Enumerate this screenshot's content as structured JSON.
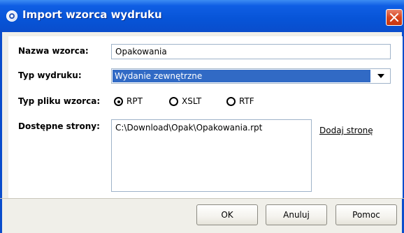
{
  "window": {
    "title": "Import wzorca wydruku",
    "icon": "app-icon"
  },
  "form": {
    "template_name": {
      "label": "Nazwa wzorca:",
      "value": "Opakowania"
    },
    "print_type": {
      "label": "Typ wydruku:",
      "selected": "Wydanie zewnętrzne"
    },
    "file_type": {
      "label": "Typ pliku wzorca:",
      "options": [
        {
          "label": "RPT",
          "checked": true
        },
        {
          "label": "XSLT",
          "checked": false
        },
        {
          "label": "RTF",
          "checked": false
        }
      ]
    },
    "pages": {
      "label": "Dostępne strony:",
      "items": [
        "C:\\Download\\Opak\\Opakowania.rpt"
      ],
      "add_link": "Dodaj stronę"
    }
  },
  "buttons": {
    "ok": "OK",
    "cancel": "Anuluj",
    "help": "Pomoc"
  },
  "colors": {
    "titlebar": "#0754d7",
    "selection": "#316ac5",
    "close": "#d8441d",
    "dialog_bg": "#f0efe9"
  }
}
